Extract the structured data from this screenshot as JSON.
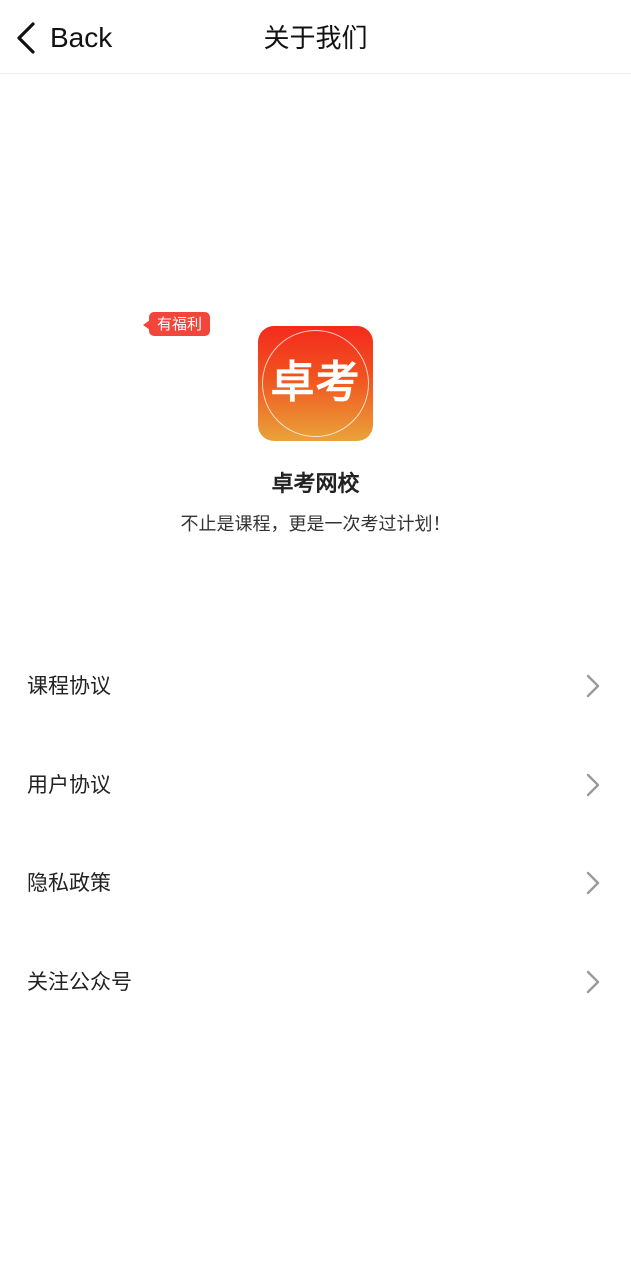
{
  "header": {
    "back_label": "Back",
    "title": "关于我们"
  },
  "app": {
    "logo_text": "卓考",
    "name": "卓考网校",
    "slogan": "不止是课程，更是一次考过计划！"
  },
  "menu": {
    "items": [
      {
        "label": "课程协议"
      },
      {
        "label": "用户协议"
      },
      {
        "label": "隐私政策"
      },
      {
        "label": "关注公众号",
        "badge": "有福利"
      }
    ]
  },
  "colors": {
    "badge": "#f2453b",
    "logo_top": "#f42a1d",
    "logo_bottom": "#e9a33a",
    "chevron": "#9a9a9a"
  },
  "icons": {
    "back": "chevron-left-icon",
    "row": "chevron-right-icon"
  }
}
